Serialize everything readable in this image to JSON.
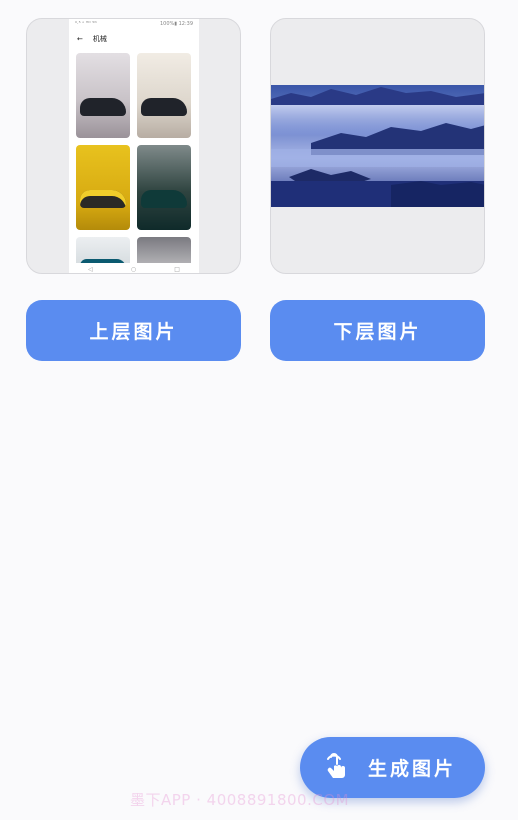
{
  "upper_preview": {
    "image_name": "phone-screenshot-car-gallery",
    "status_left": "⁰·⁵ ᵒ ᴴᴰ ⁵ᴳ",
    "status_right": "100%▮ 12:39",
    "back_icon": "back-arrow-icon",
    "title": "机械",
    "nav_icons": [
      "triangle-back-icon",
      "circle-home-icon",
      "square-recents-icon"
    ]
  },
  "lower_preview": {
    "image_name": "misty-blue-mountain-landscape"
  },
  "buttons": {
    "upper_label": "上层图片",
    "lower_label": "下层图片"
  },
  "fab": {
    "icon": "touch-hand-icon",
    "label": "生成图片"
  },
  "watermark": {
    "text": "墨下APP · 4008891800.COM"
  },
  "colors": {
    "accent": "#5a8cf0",
    "card_bg": "#ececee",
    "page_bg": "#fafafc"
  }
}
